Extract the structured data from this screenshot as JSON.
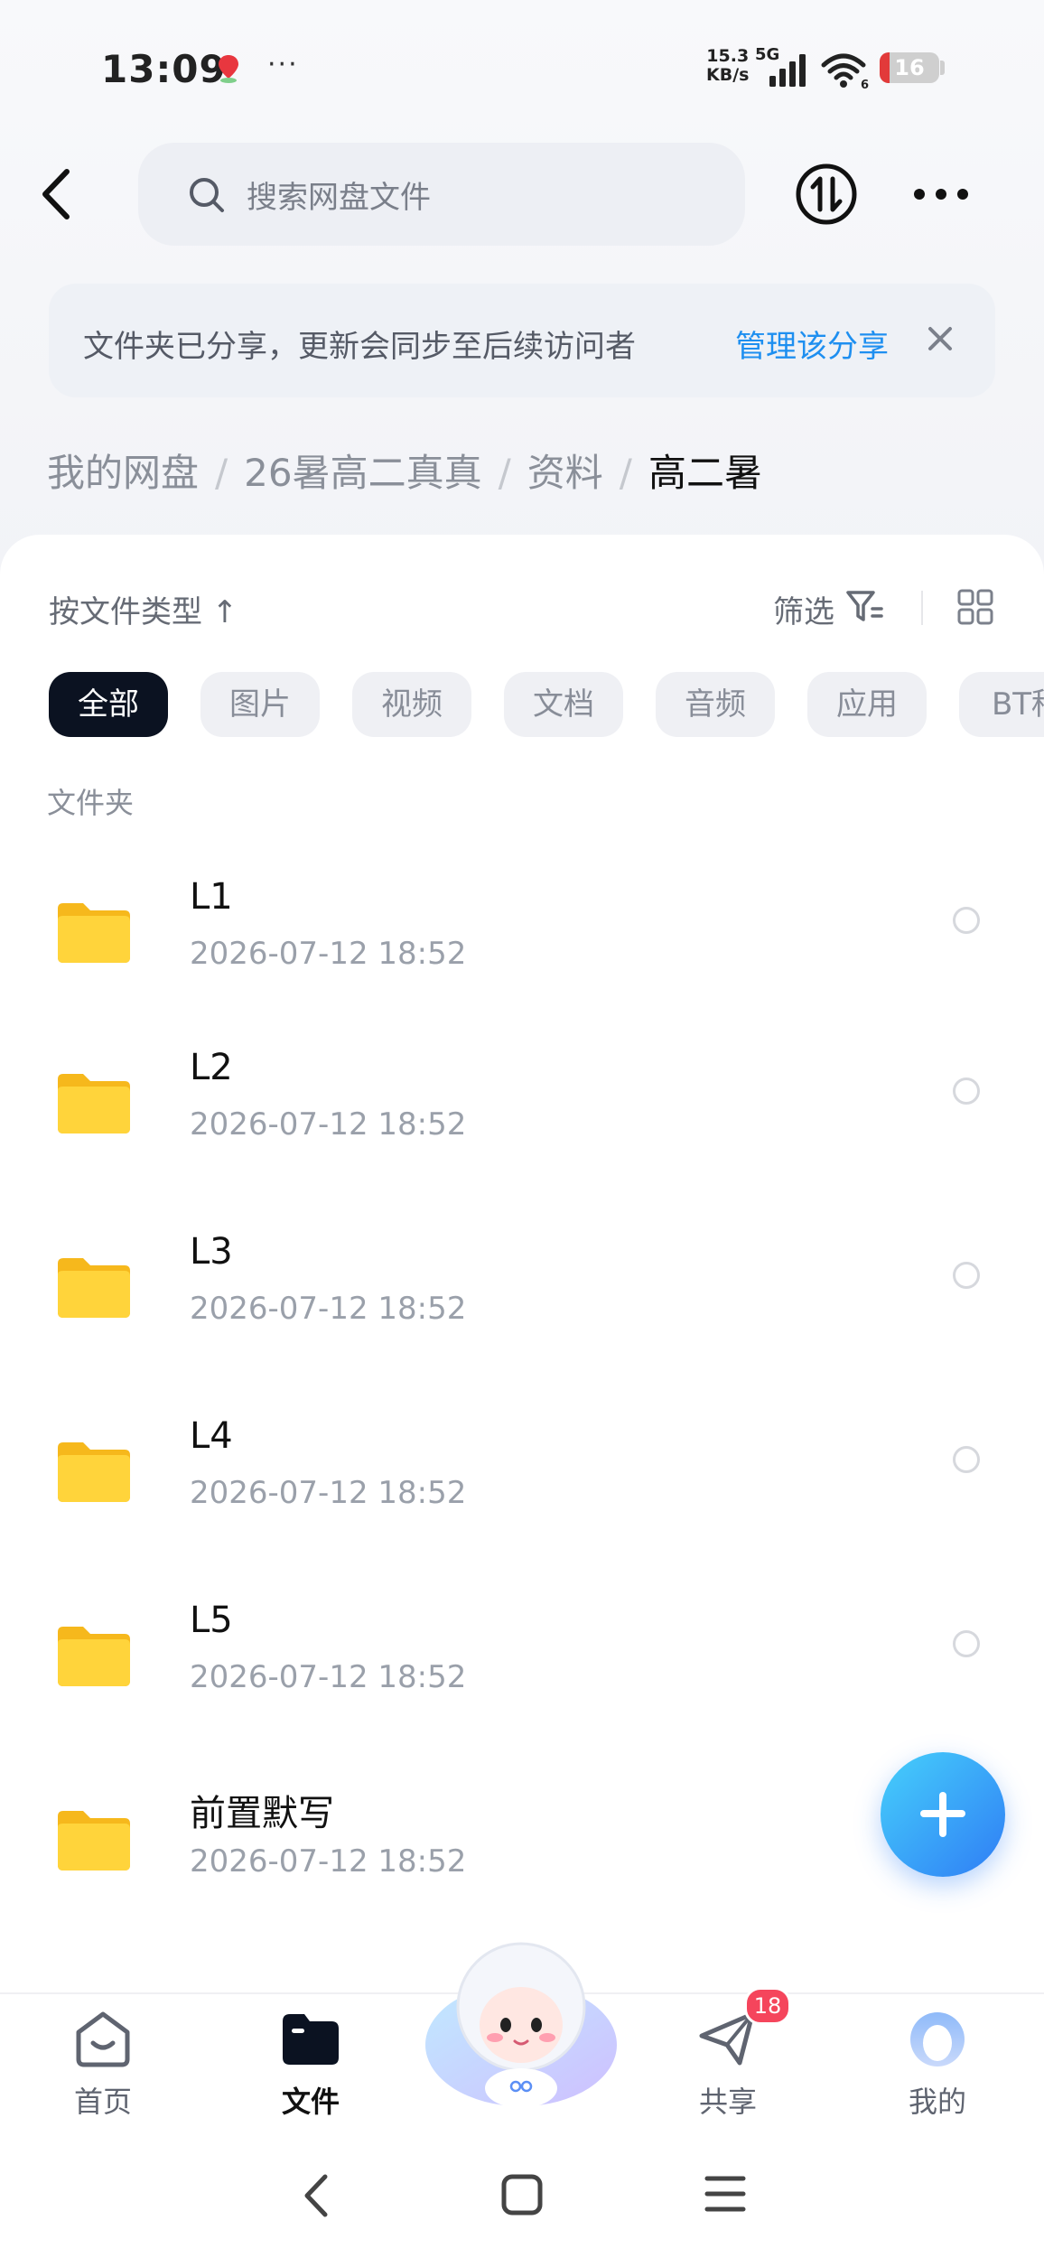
{
  "status_bar": {
    "time": "13:09",
    "more_indicator": "···",
    "net_speed_value": "15.3",
    "net_speed_unit": "KB/s",
    "network_type": "5G",
    "wifi_level": "6",
    "battery_level": "16",
    "battery_color": "#e23a3a"
  },
  "header": {
    "search_placeholder": "搜索网盘文件"
  },
  "banner": {
    "text": "文件夹已分享，更新会同步至后续访问者",
    "link": "管理该分享"
  },
  "breadcrumb": {
    "items": [
      "我的网盘",
      "26暑高二真真",
      "资料"
    ],
    "separator": "/",
    "current": "高二暑"
  },
  "toolbar": {
    "sort_label": "按文件类型 ↑",
    "filter_label": "筛选"
  },
  "filter_chips": [
    {
      "label": "全部",
      "active": true
    },
    {
      "label": "图片",
      "active": false
    },
    {
      "label": "视频",
      "active": false
    },
    {
      "label": "文档",
      "active": false
    },
    {
      "label": "音频",
      "active": false
    },
    {
      "label": "应用",
      "active": false
    },
    {
      "label": "BT种",
      "active": false
    }
  ],
  "section_title": "文件夹",
  "files": [
    {
      "name": "L1",
      "date": "2026-07-12  18:52"
    },
    {
      "name": "L2",
      "date": "2026-07-12  18:52"
    },
    {
      "name": "L3",
      "date": "2026-07-12  18:52"
    },
    {
      "name": "L4",
      "date": "2026-07-12  18:52"
    },
    {
      "name": "L5",
      "date": "2026-07-12  18:52"
    },
    {
      "name": "前置默写",
      "date": "2026-07-12  18:52"
    }
  ],
  "bottom_tabs": {
    "home": "首页",
    "files": "文件",
    "share": "共享",
    "mine": "我的",
    "share_badge": "18"
  },
  "colors": {
    "accent": "#1e8ff0",
    "fab": "#2f9ef7",
    "folder": "#ffcc33",
    "badge": "#f5455c",
    "active_chip": "#0b1221"
  },
  "icons": {
    "back": "chevron-left-icon",
    "search": "search-icon",
    "transfer": "transfer-icon",
    "more": "more-dots-icon",
    "close": "close-icon",
    "filter": "filter-icon",
    "grid": "grid-view-icon",
    "folder": "folder-icon",
    "add": "plus-icon"
  }
}
